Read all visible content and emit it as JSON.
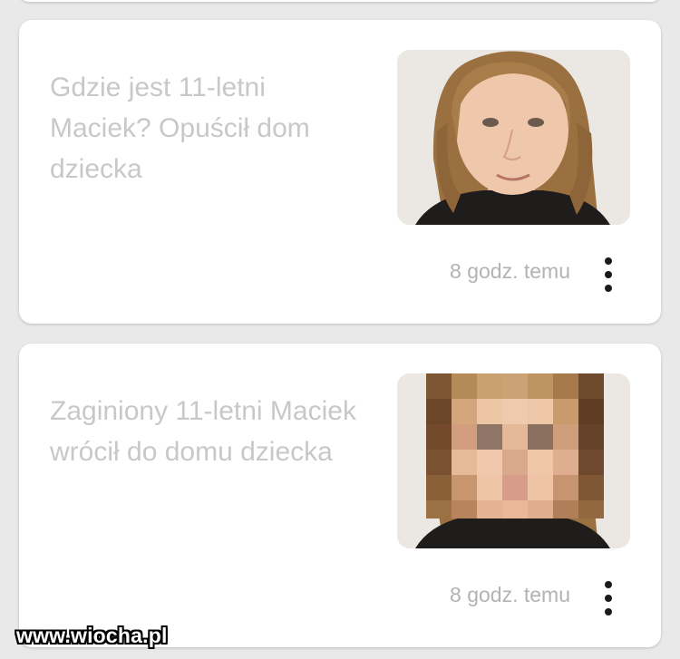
{
  "feed": {
    "items": [
      {
        "headline": "Gdzie jest 11-letni Maciek? Opuścił dom dziecka",
        "time": "8 godz. temu",
        "thumbnail": "photo of a child",
        "thumbnail_pixelated": false
      },
      {
        "headline": "Zaginiony 11-letni Maciek wrócił do domu dziecka",
        "time": "8 godz. temu",
        "thumbnail": "pixelated photo of a child",
        "thumbnail_pixelated": true
      }
    ]
  },
  "watermark": "www.wiocha.pl",
  "icons": {
    "more": "more-vertical-icon"
  },
  "colors": {
    "background": "#e9e9ea",
    "card": "#ffffff",
    "headline_text": "#c8c8ca",
    "time_text": "#b3b3b5",
    "icon": "#1a1a1a"
  }
}
